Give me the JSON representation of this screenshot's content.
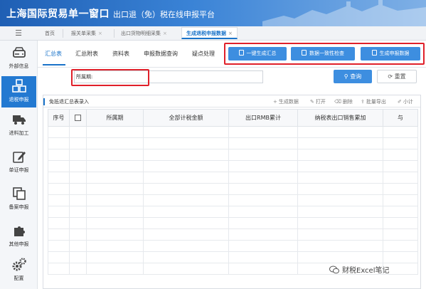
{
  "header": {
    "title": "上海国际贸易单一窗口",
    "subtitle": "出口退（免）税在线申报平台"
  },
  "top_tabs": {
    "home": "首页",
    "tab1": "报关单采集",
    "tab2": "出口货物明细采集",
    "tab3": "生成退税申报数据",
    "close_glyph": "×"
  },
  "sidebar": {
    "items": [
      {
        "label": "外部信息",
        "icon": "hard-drive-icon"
      },
      {
        "label": "退税申报",
        "icon": "cubes-icon"
      },
      {
        "label": "进料加工",
        "icon": "truck-icon"
      },
      {
        "label": "单证申报",
        "icon": "edit-icon"
      },
      {
        "label": "备案申报",
        "icon": "copy-icon"
      },
      {
        "label": "其他申报",
        "icon": "puzzle-icon"
      },
      {
        "label": "配置",
        "icon": "gears-icon"
      }
    ]
  },
  "subtabs": {
    "summary": "汇总表",
    "summary_attach": "汇总附表",
    "data_table": "资料表",
    "query": "申报数据查询",
    "doubt": "疑点处理"
  },
  "actions": {
    "one_click": "一键生成汇总",
    "consistency": "数据一致性检查",
    "generate": "生成申报数据"
  },
  "search": {
    "period_label": "所属期:",
    "period_value": "",
    "query_label": "查询",
    "reset_label": "重置"
  },
  "panel": {
    "title": "免抵退汇总表录入",
    "tools": {
      "generate": "生成数据",
      "open": "打开",
      "delete": "删除",
      "export": "批量导出",
      "subtotal": "小计"
    }
  },
  "table": {
    "columns": [
      "序号",
      "",
      "所属期",
      "全部计税金额",
      "出口RMB累计",
      "纳税表出口销售累加",
      "与"
    ]
  },
  "watermark": {
    "text": "财税Excel笔记"
  },
  "colors": {
    "primary": "#1a73c9",
    "button": "#3d8ee0",
    "highlight_border": "#e0202a",
    "header_start": "#1f5fb4"
  }
}
